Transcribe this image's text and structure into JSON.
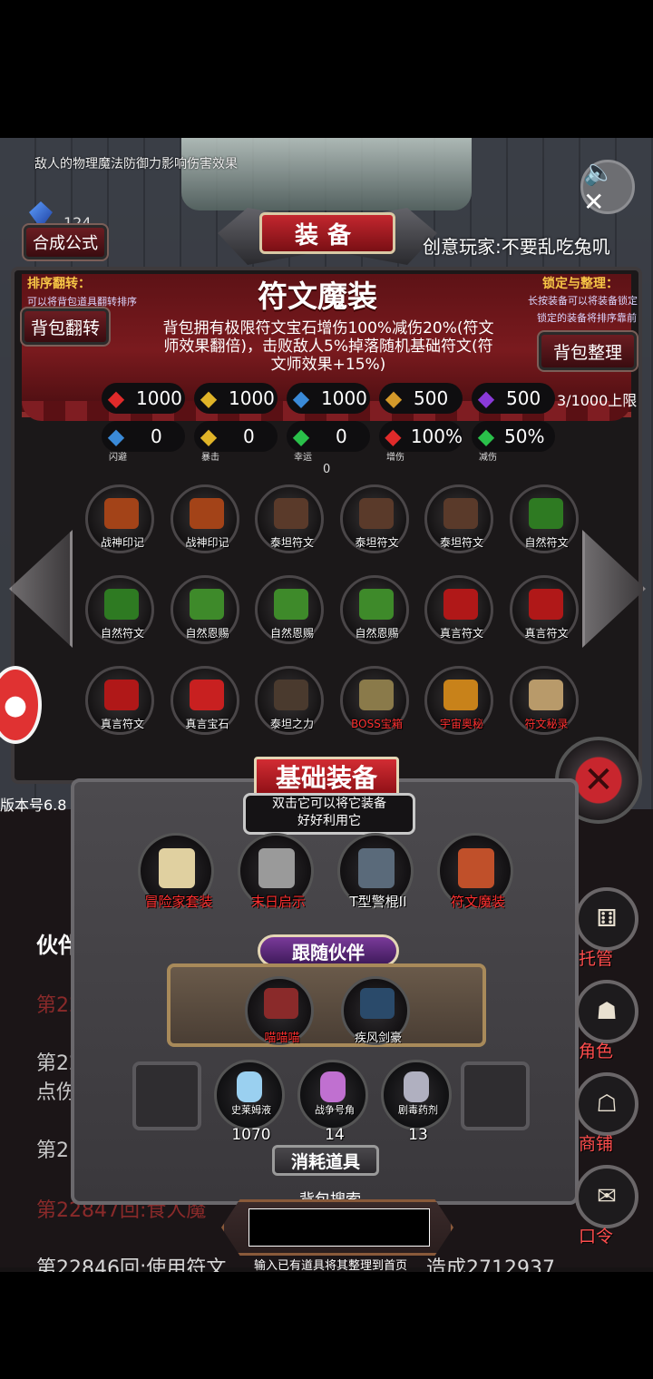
{
  "top_hint": "敌人的物理魔法防御力影响伤害效果",
  "gem_count": "124",
  "header": {
    "title": "装备",
    "synth_label": "合成公式",
    "player": "创意玩家:不要乱吃兔叽"
  },
  "left_note": {
    "title": "排序翻转：",
    "desc": "可以将背包道具翻转排序",
    "button": "背包翻转"
  },
  "right_note": {
    "title": "锁定与整理：",
    "desc1": "长按装备可以将装备锁定",
    "desc2": "锁定的装备将排序靠前",
    "button": "背包整理"
  },
  "set": {
    "name": "符文魔装",
    "desc": "背包拥有极限符文宝石增伤100%减伤20%(符文师效果翻倍)，击败敌人5%掉落随机基础符文(符文师效果+15%)"
  },
  "stats_row1": [
    {
      "icon": "heart-icon",
      "value": "1000",
      "color": "#e02a2a"
    },
    {
      "icon": "strength-icon",
      "value": "1000",
      "color": "#e0b428"
    },
    {
      "icon": "helmet-icon",
      "value": "1000",
      "color": "#3a8ad8"
    },
    {
      "icon": "staff-icon",
      "value": "500",
      "color": "#d59a2a"
    },
    {
      "icon": "lightning-icon",
      "value": "500",
      "color": "#8a3ad8"
    }
  ],
  "capacity": "3/1000上限",
  "stats_row2": [
    {
      "icon": "dodge-icon",
      "value": "0",
      "label": "闪避",
      "color": "#3a8ad8"
    },
    {
      "icon": "crit-icon",
      "value": "0",
      "label": "暴击",
      "color": "#e0b428"
    },
    {
      "icon": "clover-icon",
      "value": "0",
      "label": "幸运",
      "color": "#2ac04a"
    },
    {
      "icon": "sword-icon",
      "value": "100%",
      "label": "增伤",
      "color": "#e02a2a"
    },
    {
      "icon": "shield-icon",
      "value": "50%",
      "label": "减伤",
      "color": "#2ac04a"
    }
  ],
  "extra_zero": "0",
  "inventory": [
    {
      "label": "战神印记",
      "color": "#a34318",
      "label_color": "#ffffff"
    },
    {
      "label": "战神印记",
      "color": "#a34318",
      "label_color": "#ffffff"
    },
    {
      "label": "泰坦符文",
      "color": "#5a3a2a",
      "label_color": "#ffffff"
    },
    {
      "label": "泰坦符文",
      "color": "#5a3a2a",
      "label_color": "#ffffff"
    },
    {
      "label": "泰坦符文",
      "color": "#5a3a2a",
      "label_color": "#ffffff"
    },
    {
      "label": "自然符文",
      "color": "#2e7a22",
      "label_color": "#ffffff"
    },
    {
      "label": "自然符文",
      "color": "#2e7a22",
      "label_color": "#ffffff"
    },
    {
      "label": "自然恩赐",
      "color": "#3e8a2a",
      "label_color": "#ffffff"
    },
    {
      "label": "自然恩赐",
      "color": "#3e8a2a",
      "label_color": "#ffffff"
    },
    {
      "label": "自然恩赐",
      "color": "#3e8a2a",
      "label_color": "#ffffff"
    },
    {
      "label": "真言符文",
      "color": "#b01818",
      "label_color": "#ffffff"
    },
    {
      "label": "真言符文",
      "color": "#b01818",
      "label_color": "#ffffff"
    },
    {
      "label": "真言符文",
      "color": "#b01818",
      "label_color": "#ffffff"
    },
    {
      "label": "真言宝石",
      "color": "#c82020",
      "label_color": "#ffffff"
    },
    {
      "label": "泰坦之力",
      "color": "#4a3a2e",
      "label_color": "#ffffff"
    },
    {
      "label": "BOSS宝箱",
      "color": "#8a7a4a",
      "label_color": "#ff3030"
    },
    {
      "label": "宇宙奥秘",
      "color": "#c8821a",
      "label_color": "#ff3030"
    },
    {
      "label": "符文秘录",
      "color": "#b89a6a",
      "label_color": "#ff3030"
    }
  ],
  "version": "版本号6.8",
  "base_equip": {
    "title": "基础装备",
    "hint1": "双击它可以将它装备",
    "hint2": "好好利用它",
    "items": [
      {
        "label": "冒险家套装",
        "color": "#e0d0a0",
        "label_color": "#ff3030"
      },
      {
        "label": "末日启示",
        "color": "#9a9a9a",
        "label_color": "#ff3030"
      },
      {
        "label": "T型警棍II",
        "color": "#5a6a7a",
        "label_color": "#ffffff"
      },
      {
        "label": "符文魔装",
        "color": "#c0502a",
        "label_color": "#ff3030"
      }
    ]
  },
  "partner": {
    "title": "跟随伙伴",
    "items": [
      {
        "label": "喵喵喵",
        "color": "#8a2a2a",
        "label_color": "#ff3030"
      },
      {
        "label": "疾风剑豪",
        "color": "#2a4a6a",
        "label_color": "#ffffff"
      }
    ]
  },
  "consumables": {
    "title": "消耗道具",
    "items": [
      {
        "label": "史莱姆液",
        "count": "1070",
        "color": "#9ad0f0"
      },
      {
        "label": "战争号角",
        "count": "14",
        "color": "#c070d0"
      },
      {
        "label": "剧毒药剂",
        "count": "13",
        "color": "#b0b0c0"
      }
    ]
  },
  "search": {
    "title": "背包搜索",
    "hint": "输入已有道具将其整理到首页"
  },
  "right_menu": [
    {
      "icon": "dice-icon",
      "label": "托管"
    },
    {
      "icon": "hood-icon",
      "label": "角色"
    },
    {
      "icon": "shop-icon",
      "label": "商铺"
    },
    {
      "icon": "scroll-icon",
      "label": "口令"
    }
  ],
  "log": {
    "partner_label": "伙伴",
    "line1": "第22",
    "line2": "第22",
    "line2b": "点伤",
    "line3": "第2",
    "line4": "第22847回:食人魔",
    "line5": "第22846回:使用符文",
    "line5_tail": "造成2712937"
  }
}
